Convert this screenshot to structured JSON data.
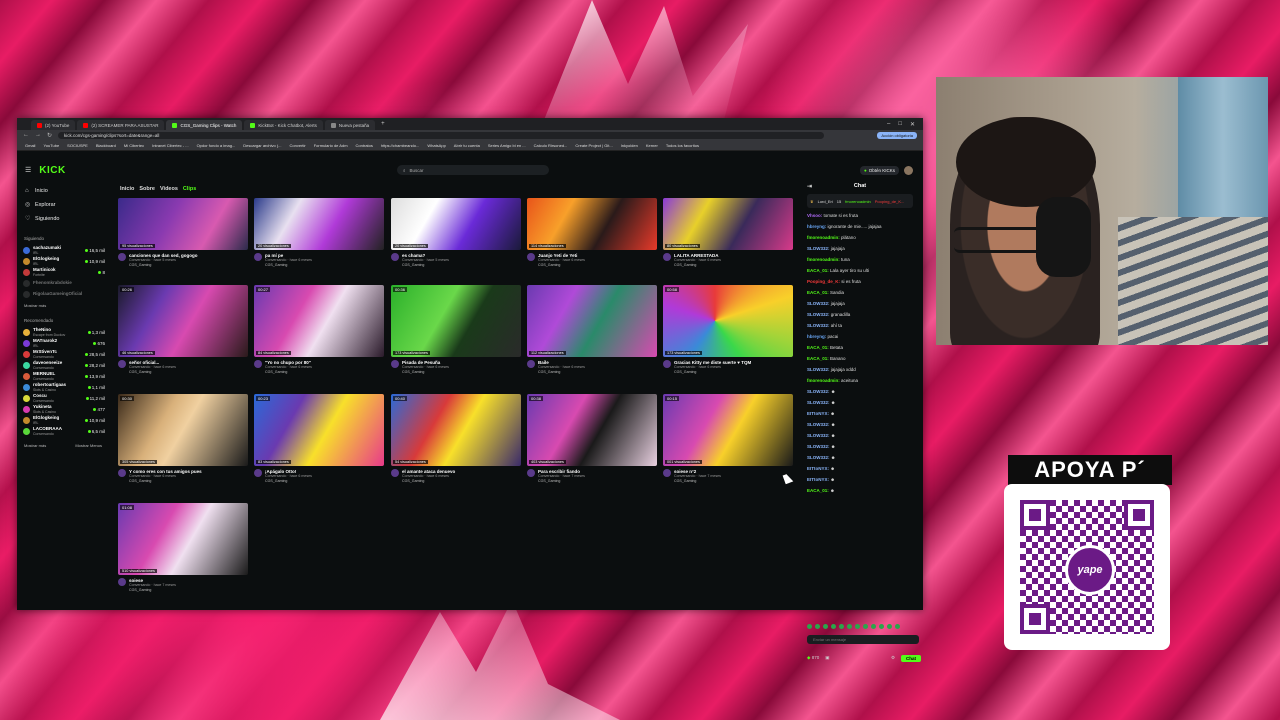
{
  "tabs": [
    {
      "label": "(2) YouTube",
      "color": "#ff0000"
    },
    {
      "label": "(2) SCREAMER PARA ASUSTAR",
      "color": "#ff0000"
    },
    {
      "label": "CGS_Gaming Clips - Watch",
      "color": "#53fc18",
      "active": true
    },
    {
      "label": "KickBot - Kick Chatbot, Alerts",
      "color": "#53fc18"
    },
    {
      "label": "Nueva pestaña",
      "color": "#888888"
    }
  ],
  "address": {
    "url": "kick.com/cgs-gaming/clips?sort=date&range=all",
    "update_label": "Acción obligatoria"
  },
  "bookmarks": [
    "Gmail",
    "YouTube",
    "SOCIUSPE",
    "Blackboard",
    "Mi Cibertec",
    "Intranet Cibertec - ...",
    "Opdor fondo a imag...",
    "Descargar archivo (...",
    "Convertir",
    "Formulario de Adm",
    "Contratos",
    "https://chambeando...",
    "WhatsApp",
    "Abrir tu cuenta",
    "Series Amigo bi en ...",
    "Calculo Rirsoned...",
    "Create Project | Git...",
    "Inkyolden",
    "Kerner",
    "Todos los favoritos"
  ],
  "kick": {
    "logo": "KICK",
    "search_placeholder": "Buscar",
    "get_kicks": "Obtén KICKs"
  },
  "sidebar": {
    "nav": [
      {
        "label": "Inicio",
        "icon": "home-icon"
      },
      {
        "label": "Explorar",
        "icon": "compass-icon"
      },
      {
        "label": "Siguiendo",
        "icon": "heart-icon"
      }
    ],
    "following_title": "Siguiendo",
    "following": [
      {
        "name": "sachazumaki",
        "cat": "IRL",
        "value": "16,5 mil",
        "color": "#3b6bd8"
      },
      {
        "name": "ElGlogkeing",
        "cat": "IRL",
        "value": "10,9 mil",
        "color": "#c48a2c"
      },
      {
        "name": "Martinicok",
        "cat": "Fortnite",
        "value": "8",
        "color": "#c23a3a"
      },
      {
        "name": "Fhenomkrabdokie",
        "cat": "",
        "value": "",
        "color": "#555555",
        "off": true
      },
      {
        "name": "RigolaaGameingOficial",
        "cat": "",
        "value": "",
        "color": "#555555",
        "off": true
      }
    ],
    "show_more": "Mostrar más",
    "recommended_title": "Recomendado",
    "recommended": [
      {
        "name": "TheNino",
        "cat": "Escape from Duckov",
        "value": "1,3 mil",
        "color": "#e8b23a"
      },
      {
        "name": "MATnarok2",
        "cat": "IRL",
        "value": "676",
        "color": "#7b3ad8"
      },
      {
        "name": "MrStivenTc",
        "cat": "Conversando",
        "value": "28,5 mil",
        "color": "#d83a3a"
      },
      {
        "name": "daveoeneeize",
        "cat": "Conversando",
        "value": "28,2 mil",
        "color": "#3ad8a0"
      },
      {
        "name": "MERNUEL",
        "cat": "Conversando",
        "value": "13,9 mil",
        "color": "#d85a3a"
      },
      {
        "name": "robertoartigaas",
        "cat": "Slots & Casino",
        "value": "1,1 mil",
        "color": "#3a8ad8"
      },
      {
        "name": "Coscu",
        "cat": "Conversando",
        "value": "11,2 mil",
        "color": "#d8d83a"
      },
      {
        "name": "Yukineta",
        "cat": "Slots & Casino",
        "value": "477",
        "color": "#d83ab0"
      },
      {
        "name": "ElGlogkeing",
        "cat": "IRL",
        "value": "10,9 mil",
        "color": "#c48a2c"
      },
      {
        "name": "LACOBRAAA",
        "cat": "Conversando",
        "value": "6,5 mil",
        "color": "#5ad83a"
      }
    ],
    "show_more_2": "Mostrar más",
    "show_less": "Mostrar Menos"
  },
  "main_tabs": [
    {
      "label": "Inicio",
      "active": false
    },
    {
      "label": "Sobre",
      "active": false
    },
    {
      "label": "Videos",
      "active": false
    },
    {
      "label": "Clips",
      "active": true
    }
  ],
  "clips": [
    {
      "title": "canciones que dan sed, gogogo",
      "views": "95 visualizaciones",
      "dur": "",
      "cat": "Conversando · hace 5 meses",
      "channel": "CGS_Gaming",
      "bg": "linear-gradient(120deg,#3a2a8a,#8a3ab0 40%,#d85ab0 70%,#2a2a4a)"
    },
    {
      "title": "pa mí pe",
      "views": "20 visualizaciones",
      "dur": "",
      "cat": "Conversando · hace 6 meses",
      "channel": "CGS_Gaming",
      "bg": "linear-gradient(120deg,#2a3a8a,#e8e0f0 30%,#b03ad8 60%,#222)"
    },
    {
      "title": "es chama?",
      "views": "20 visualizaciones",
      "dur": "",
      "cat": "Conversando · hace 5 meses",
      "channel": "CGS_Gaming",
      "bg": "linear-gradient(120deg,#ddd,#fff 30%,#6a2ad8 60%,#1a1a3a)"
    },
    {
      "title": "Juanjo Yeti de Yeti",
      "views": "114 visualizaciones",
      "dur": "",
      "cat": "Conversando · hace 6 meses",
      "channel": "CGS_Gaming",
      "bg": "linear-gradient(120deg,#e8541a,#f8a02a 30%,#2a1a1a 60%,#e83a2a)"
    },
    {
      "title": "LALITA ARRESTADA",
      "views": "80 visualizaciones",
      "dur": "",
      "cat": "Conversando · hace 6 meses",
      "channel": "CGS_Gaming",
      "bg": "linear-gradient(120deg,#8a3ad8,#e8d02a 30%,#3a2a5a 60%,#d83a8a)"
    },
    {
      "title": "señor oficial...",
      "views": "46 visualizaciones",
      "dur": "00:26",
      "cat": "Conversando · hace 6 meses",
      "channel": "CGS_Gaming",
      "bg": "linear-gradient(120deg,#1a1a2a,#6a3ab0 30%,#d84ab0 55%,#2a1a1a)"
    },
    {
      "title": "\"Yo no chupo por 80\"",
      "views": "84 visualizaciones",
      "dur": "00:27",
      "cat": "Conversando · hace 6 meses",
      "channel": "CGS_Gaming",
      "bg": "linear-gradient(120deg,#6a3ab0,#d84ab0 35%,#f0e0f0 55%,#2a1a2a)"
    },
    {
      "title": "Pisada de Pesuña",
      "views": "173 visualizaciones",
      "dur": "00:36",
      "cat": "Conversando · hace 6 meses",
      "channel": "CGS_Gaming",
      "bg": "linear-gradient(120deg,#2ab02a,#6ad84a 40%,#1a3a1a 60%,#2a2a2a)"
    },
    {
      "title": "Baile",
      "views": "112 visualizaciones",
      "dur": "",
      "cat": "Conversando · hace 6 meses",
      "channel": "CGS_Gaming",
      "bg": "linear-gradient(120deg,#6a3ab0,#b04ad8 30%,#2a8a6a 55%,#d84ab0)"
    },
    {
      "title": "Gracias Kitty me diste suerte ♥ TQM",
      "views": "173 visualizaciones",
      "dur": "00:58",
      "cat": "Conversando · hace 6 meses",
      "channel": "CGS_Gaming",
      "bg": "conic-gradient(from 0deg at 40% 50%,#e83a3a,#f8d02a,#3ad84a,#3a8ad8,#b03ad8,#e83a3a)"
    },
    {
      "title": "Y como eres con tus amigos pues",
      "views": "305 visualizaciones",
      "dur": "00:30",
      "cat": "Conversando · hace 6 meses",
      "channel": "CGS_Gaming",
      "bg": "linear-gradient(120deg,#3a2a1a,#d8b07a 35%,#f0d0a0 50%,#1a1a1a)"
    },
    {
      "title": "¡Apágalo Otto!",
      "views": "83 visualizaciones",
      "dur": "00:23",
      "cat": "Conversando · hace 6 meses",
      "channel": "CGS_Gaming",
      "bg": "linear-gradient(120deg,#2a6ad8,#6a3ab0 30%,#f8e02a 55%,#e83a8a)"
    },
    {
      "title": "el amante ataca denuevo",
      "views": "54 visualizaciones",
      "dur": "00:40",
      "cat": "Conversando · hace 6 meses",
      "channel": "CGS_Gaming",
      "bg": "linear-gradient(120deg,#2a6ad8,#d83a3a 35%,#f8e02a 55%,#3a2a6a)"
    },
    {
      "title": "Para escribir fiando",
      "views": "403 visualizaciones",
      "dur": "00:38",
      "cat": "Conversando · hace 7 meses",
      "channel": "CGS_Gaming",
      "bg": "linear-gradient(120deg,#6a3ab0,#d84ab0 35%,#1a1a1a 55%,#e8d0e0)"
    },
    {
      "title": "soiese n°2",
      "views": "001 visualizaciones",
      "dur": "00:15",
      "cat": "Conversando · hace 7 meses",
      "channel": "CGS_Gaming",
      "bg": "linear-gradient(120deg,#6a3ab0,#d84ab0 35%,#f8d02a 55%,#1a1a1a)"
    },
    {
      "title": "soiese",
      "views": "510 visualizaciones",
      "dur": "01:08",
      "cat": "Conversando · hace 7 meses",
      "channel": "CGS_Gaming",
      "bg": "linear-gradient(120deg,#6a3ab0,#d84ab0 35%,#f0e0f0 55%,#1a1a1a)"
    }
  ],
  "chat": {
    "title": "Chat",
    "pinned": {
      "user": "Lord_Eri",
      "count": "15",
      "top": "fmorenoadmin",
      "top2": "Pooping_de_K..."
    },
    "messages": [
      {
        "user": "Vhsoo:",
        "text": "tomate si es fruta",
        "color": "#b06af8"
      },
      {
        "user": "hbreyng:",
        "text": "ignorante de mie..... jajajaa",
        "color": "#6aa8f8"
      },
      {
        "user": "fmorenoadmin:",
        "text": "plátano",
        "color": "#53fc18"
      },
      {
        "user": "SLOW332:",
        "text": "jajajaja",
        "color": "#8ab4f8"
      },
      {
        "user": "fmorenoadmin:",
        "text": "tuna",
        "color": "#53fc18"
      },
      {
        "user": "EACA_01:",
        "text": "Lala ayer tiro su ulti",
        "color": "#53fc18"
      },
      {
        "user": "Pooping_de_K:",
        "text": "si es fruta",
        "color": "#f83a3a"
      },
      {
        "user": "EACA_01:",
        "text": "Sandia",
        "color": "#53fc18"
      },
      {
        "user": "SLOW332:",
        "text": "jajajaja",
        "color": "#8ab4f8"
      },
      {
        "user": "SLOW332:",
        "text": "granadilla",
        "color": "#8ab4f8"
      },
      {
        "user": "SLOW332:",
        "text": "ahí ta",
        "color": "#8ab4f8"
      },
      {
        "user": "hbreyng:",
        "text": "pacai",
        "color": "#6aa8f8"
      },
      {
        "user": "EACA_01:",
        "text": "Betata",
        "color": "#53fc18"
      },
      {
        "user": "EACA_01:",
        "text": "Banano",
        "color": "#53fc18"
      },
      {
        "user": "SLOW332:",
        "text": "jajajaja xddd",
        "color": "#8ab4f8"
      },
      {
        "user": "fmorenoadmin:",
        "text": "aceituna",
        "color": "#53fc18"
      },
      {
        "user": "SLOW332:",
        "text": "☻",
        "color": "#8ab4f8"
      },
      {
        "user": "SLOW332:",
        "text": "☻",
        "color": "#8ab4f8"
      },
      {
        "user": "EITtoNYX:",
        "text": "☻",
        "color": "#8ab4f8"
      },
      {
        "user": "SLOW332:",
        "text": "☻",
        "color": "#8ab4f8"
      },
      {
        "user": "SLOW332:",
        "text": "☻",
        "color": "#8ab4f8"
      },
      {
        "user": "SLOW332:",
        "text": "☻",
        "color": "#8ab4f8"
      },
      {
        "user": "SLOW332:",
        "text": "☻",
        "color": "#8ab4f8"
      },
      {
        "user": "EITtoNYX:",
        "text": "☻",
        "color": "#8ab4f8"
      },
      {
        "user": "EITtoNYX:",
        "text": "☻",
        "color": "#8ab4f8"
      },
      {
        "user": "EACA_01:",
        "text": "☻",
        "color": "#53fc18"
      }
    ],
    "input_placeholder": "Enviar un mensaje",
    "kicks": "870",
    "send_label": "Chat"
  },
  "overlay": {
    "support_text": "APOYA P´",
    "qr_brand": "yape"
  }
}
